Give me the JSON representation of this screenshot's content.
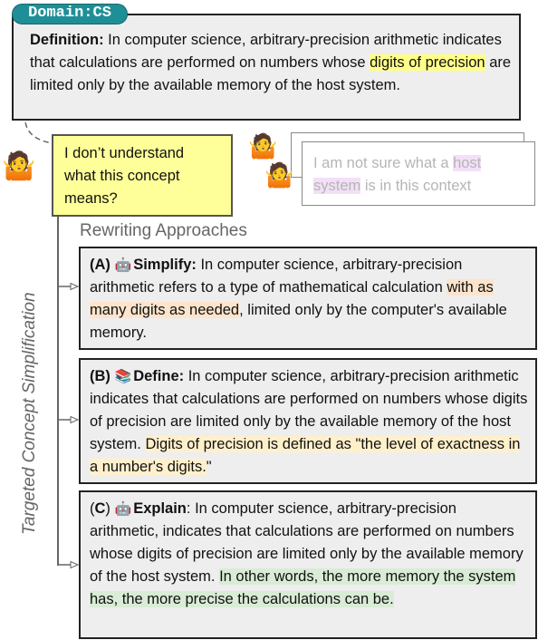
{
  "domain_tag": "Domain:CS",
  "definition": {
    "label": "Definition:",
    "text_before": " In computer science, arbitrary-precision arithmetic indicates that calculations are performed on numbers whose ",
    "highlight": "digits of precision",
    "text_after": " are limited only by the available memory of the host system."
  },
  "question": {
    "icon": "person-shrugging-icon",
    "text": "I don’t understand what this concept means?"
  },
  "alternate_question": {
    "icon": "person-shrugging-icon",
    "text_before": "I am not sure what a ",
    "highlight": "host system",
    "text_after": " is in this context"
  },
  "section_title": "Rewriting Approaches",
  "vertical_label": "Targeted Concept Simplification",
  "approaches": [
    {
      "letter": "(A)",
      "icon": "robot-icon",
      "icon_glyph": "🤖",
      "name": "Simplify:",
      "text_before": " In computer science, arbitrary-precision arithmetic refers to a type of mathematical calculation ",
      "highlight": "with as many digits as needed",
      "text_after": ", limited only by the computer's available memory.",
      "highlight_color": "#fde4cc"
    },
    {
      "letter": "(B)",
      "icon": "books-icon",
      "icon_glyph": "📚",
      "name": "Define:",
      "text_before": " In computer science, arbitrary-precision arithmetic indicates that calculations are performed on numbers whose digits of precision are limited only by the available memory of the host system. ",
      "highlight": "Digits of precision is defined as \"the level of exactness in a number's digits.",
      "text_after": "\"",
      "highlight_color": "#fff0cc"
    },
    {
      "letter": "(C)",
      "icon": "robot-icon",
      "icon_glyph": "🤖",
      "name": "Explain",
      "name_suffix": ":",
      "text_before": " In computer science, arbitrary-precision arithmetic, indicates that calculations are performed on numbers whose digits of precision are limited only by the available memory of the host system. ",
      "highlight": "In other words, the more memory the system has, the more precise the calculations can be.",
      "text_after": "",
      "highlight_color": "#d9ecd6"
    }
  ],
  "colors": {
    "domain_tag": "#1f8f97",
    "question_bg": "#ffff99",
    "box_bg": "#eeeeee",
    "highlight_definition": "#ffff88",
    "highlight_host_system": "#f3e0f7"
  }
}
